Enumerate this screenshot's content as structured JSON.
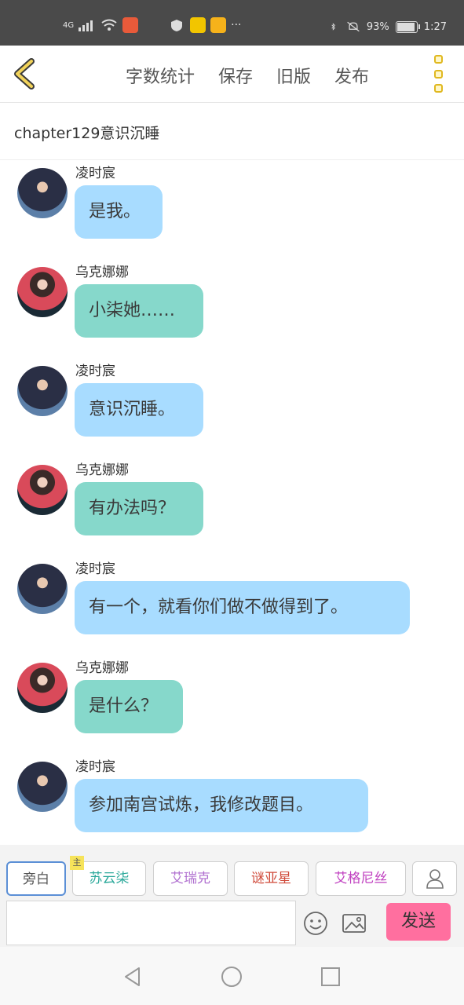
{
  "status_bar": {
    "network": "4G",
    "battery": "93%",
    "battery_level": 0.93,
    "time": "1:27",
    "more": "···"
  },
  "toolbar": {
    "actions": [
      "字数统计",
      "保存",
      "旧版",
      "发布"
    ]
  },
  "chapter": {
    "title": "chapter129意识沉睡"
  },
  "messages": [
    {
      "sender": "凌时宸",
      "text": "是我。",
      "side": "blue"
    },
    {
      "sender": "乌克娜娜",
      "text": "小柒她……",
      "side": "teal"
    },
    {
      "sender": "凌时宸",
      "text": "意识沉睡。",
      "side": "blue"
    },
    {
      "sender": "乌克娜娜",
      "text": "有办法吗？",
      "side": "teal"
    },
    {
      "sender": "凌时宸",
      "text": "有一个，就看你们做不做得到了。",
      "side": "blue"
    },
    {
      "sender": "乌克娜娜",
      "text": "是什么？",
      "side": "teal"
    },
    {
      "sender": "凌时宸",
      "text": "参加南宫试炼，我修改题目。",
      "side": "blue"
    }
  ],
  "composer": {
    "roles": [
      {
        "label": "旁白",
        "color": "#555555"
      },
      {
        "label": "苏云柒",
        "color": "#2aa89a",
        "tag": "主"
      },
      {
        "label": "艾瑞克",
        "color": "#b070d0"
      },
      {
        "label": "谜亚星",
        "color": "#d04a3a"
      },
      {
        "label": "艾格尼丝",
        "color": "#c040c0"
      }
    ],
    "input_value": "",
    "send_label": "发送"
  },
  "colors": {
    "accent_blue": "#a8dcff",
    "accent_teal": "#86d8cb",
    "send_pink": "#ff6f9f",
    "status_bar": "#4a4a4a"
  }
}
